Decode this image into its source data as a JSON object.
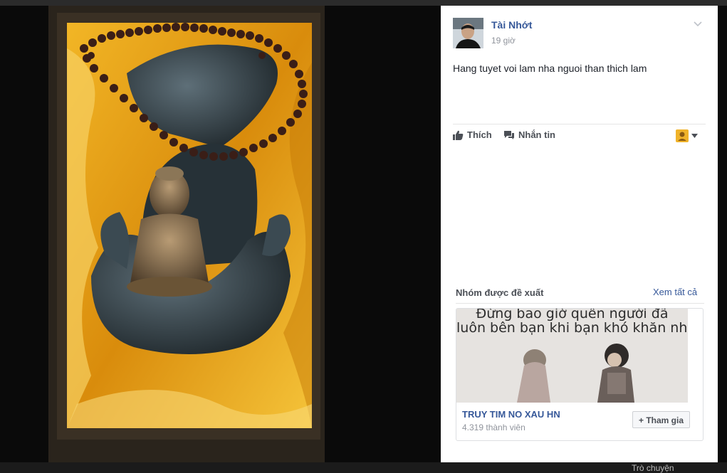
{
  "post": {
    "author": "Tài Nhớt",
    "time": "19 giờ",
    "caption": "Hang tuyet voi lam nha nguoi than thich lam"
  },
  "actions": {
    "like": "Thích",
    "message": "Nhắn tin"
  },
  "suggested_groups": {
    "title": "Nhóm được đề xuất",
    "see_all": "Xem tất cả",
    "group": {
      "cover_text_line1": "Đừng bao giờ quên người đã",
      "cover_text_line2": "luôn bên bạn khi bạn khó khăn nhất",
      "name": "TRUY TIM NO XAU HN",
      "members": "4.319 thành viên",
      "join_label": "+ Tham gia"
    }
  },
  "chat_bar": {
    "label": "Trò chuyện"
  },
  "colors": {
    "link_blue": "#365899",
    "muted_text": "#90949c",
    "body_text": "#1d2129",
    "photo_satin": "#e8a317"
  }
}
